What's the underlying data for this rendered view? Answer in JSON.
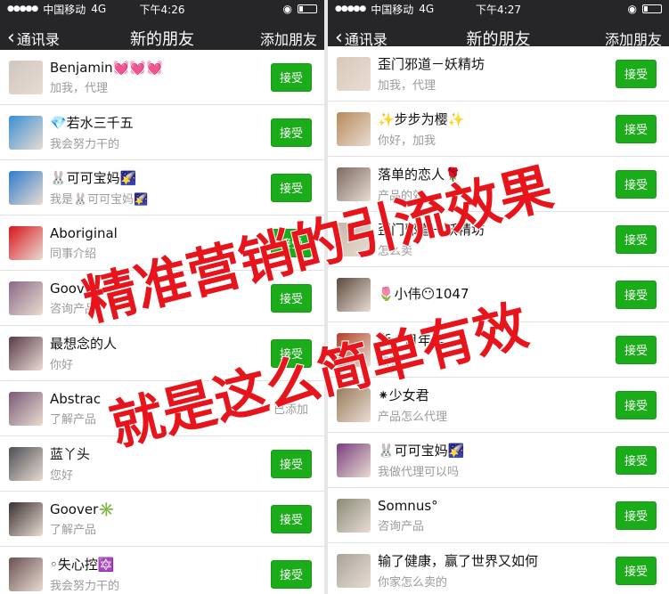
{
  "left_screen": {
    "status": {
      "carrier": "中国移动",
      "network": "4G",
      "time": "下午4:26"
    },
    "nav": {
      "back_label": "通讯录",
      "title": "新的朋友",
      "action": "添加朋友"
    },
    "rows": [
      {
        "name": "Benjamin💓💓💓",
        "msg": "加我，代理",
        "button": "接受",
        "avatar_color": "#cfc6c0"
      },
      {
        "name": "💎若水三千五",
        "msg": "我会努力干的",
        "button": "接受",
        "avatar_color": "#3a8fd4"
      },
      {
        "name": "🐰可可宝妈🌠",
        "msg": "我是🐰可可宝妈🌠",
        "button": "接受",
        "avatar_color": "#2f7dc9"
      },
      {
        "name": "Aboriginal",
        "msg": "同事介绍",
        "button": "接受",
        "avatar_color": "#d9141b"
      },
      {
        "name": "Goover",
        "msg": "咨询产品",
        "button": "接受",
        "avatar_color": "#8c6a86"
      },
      {
        "name": "最想念的人",
        "msg": "你好",
        "button": "接受",
        "avatar_color": "#5a3a4a"
      },
      {
        "name": "Abstrac",
        "msg": "了解产品",
        "button": "已添加",
        "avatar_color": "#7a5a76"
      },
      {
        "name": "蓝丫头",
        "msg": "您好",
        "button": "接受",
        "avatar_color": "#4d4f56"
      },
      {
        "name": "Goover✳️",
        "msg": "了解产品",
        "button": "接受",
        "avatar_color": "#3b3032"
      },
      {
        "name": "◦失心控🔯",
        "msg": "我会努力干的",
        "button": "接受",
        "avatar_color": "#6b5054"
      }
    ]
  },
  "right_screen": {
    "status": {
      "carrier": "中国移动",
      "network": "4G",
      "time": "下午4:27"
    },
    "nav": {
      "back_label": "通讯录",
      "title": "新的朋友",
      "action": "添加朋友"
    },
    "rows": [
      {
        "name": "歪门邪道－妖精坊",
        "msg": "加我，代理",
        "button": "接受",
        "avatar_color": "#d8c9bb"
      },
      {
        "name": "✨步步为樱✨",
        "msg": "你好，加我",
        "button": "接受",
        "avatar_color": "#b68a5c"
      },
      {
        "name": "落单的恋人🌹",
        "msg": "产品的效",
        "button": "接受",
        "avatar_color": "#7b6a62"
      },
      {
        "name": "歪门邪道－妖精坊",
        "msg": "怎么卖",
        "button": "接受",
        "avatar_color": "#c9b6a8"
      },
      {
        "name": "🌷小伟😶1047",
        "msg": "",
        "button": "接受",
        "avatar_color": "#5b4a3e"
      },
      {
        "name": "逝　月年华",
        "msg": "加我",
        "button": "接受",
        "avatar_color": "#b04028"
      },
      {
        "name": "⁕少女君",
        "msg": "产品怎么代理",
        "button": "接受",
        "avatar_color": "#9a7b5c"
      },
      {
        "name": "🐰可可宝妈🌠",
        "msg": "我做代理可以吗",
        "button": "接受",
        "avatar_color": "#7a3e7e"
      },
      {
        "name": "Somnus°",
        "msg": "咨询产品",
        "button": "接受",
        "avatar_color": "#8a8a78"
      },
      {
        "name": "输了健康，赢了世界又如何",
        "msg": "你家怎么卖的",
        "button": "接受",
        "avatar_color": "#a9a39a"
      }
    ]
  },
  "overlay_text": {
    "line1": "精准营销的引流效果",
    "line2": "就是这么简单有效",
    "color": "#e8141b"
  }
}
